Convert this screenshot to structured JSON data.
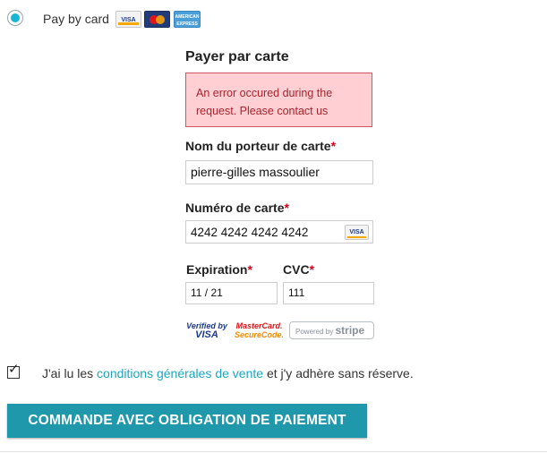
{
  "payment_option": {
    "label": "Pay by card",
    "selected": true,
    "card_logos": [
      "visa-logo",
      "mastercard-logo",
      "amex-logo"
    ]
  },
  "card_form": {
    "title": "Payer par carte",
    "error_message": "An error occured during the request. Please contact us",
    "cardholder": {
      "label": "Nom du porteur de carte",
      "required_mark": "*",
      "value": "pierre-gilles massoulier"
    },
    "card_number": {
      "label": "Numéro de carte",
      "required_mark": "*",
      "value": "4242 4242 4242 4242",
      "brand_icon": "visa-logo"
    },
    "expiration": {
      "label": "Expiration",
      "required_mark": "*",
      "value": "11 / 21"
    },
    "cvc": {
      "label": "CVC",
      "required_mark": "*",
      "value": "111"
    }
  },
  "badges": {
    "verified_by_visa": {
      "line1": "Verified by",
      "line2": "VISA"
    },
    "mastercard_securecode": {
      "line1": "MasterCard.",
      "line2": "SecureCode."
    },
    "powered_by_stripe": {
      "prefix": "Powered by",
      "brand": "stripe"
    }
  },
  "terms": {
    "checked": true,
    "text_before": "J'ai lu les ",
    "link_text": "conditions générales de vente",
    "text_after": " et j'y adhère sans réserve."
  },
  "order_button": {
    "label": "COMMANDE AVEC OBLIGATION DE PAIEMENT"
  },
  "colors": {
    "accent": "#1aa6c1",
    "button": "#1f98ac",
    "error_bg": "#ffcfd3",
    "error_border": "#d35462",
    "error_text": "#a8252e",
    "required": "#d0021b"
  }
}
